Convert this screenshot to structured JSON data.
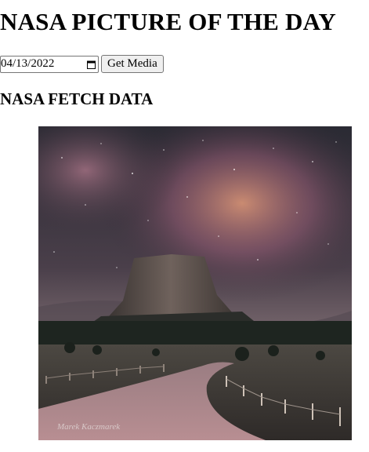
{
  "header": {
    "title": "NASA PICTURE OF THE DAY"
  },
  "controls": {
    "date_value": "04/13/2022",
    "get_media_label": "Get Media"
  },
  "section": {
    "heading": "NASA FETCH DATA"
  },
  "media": {
    "watermark": "Marek Kaczmarek"
  },
  "icons": {
    "date_picker": "calendar-icon"
  }
}
